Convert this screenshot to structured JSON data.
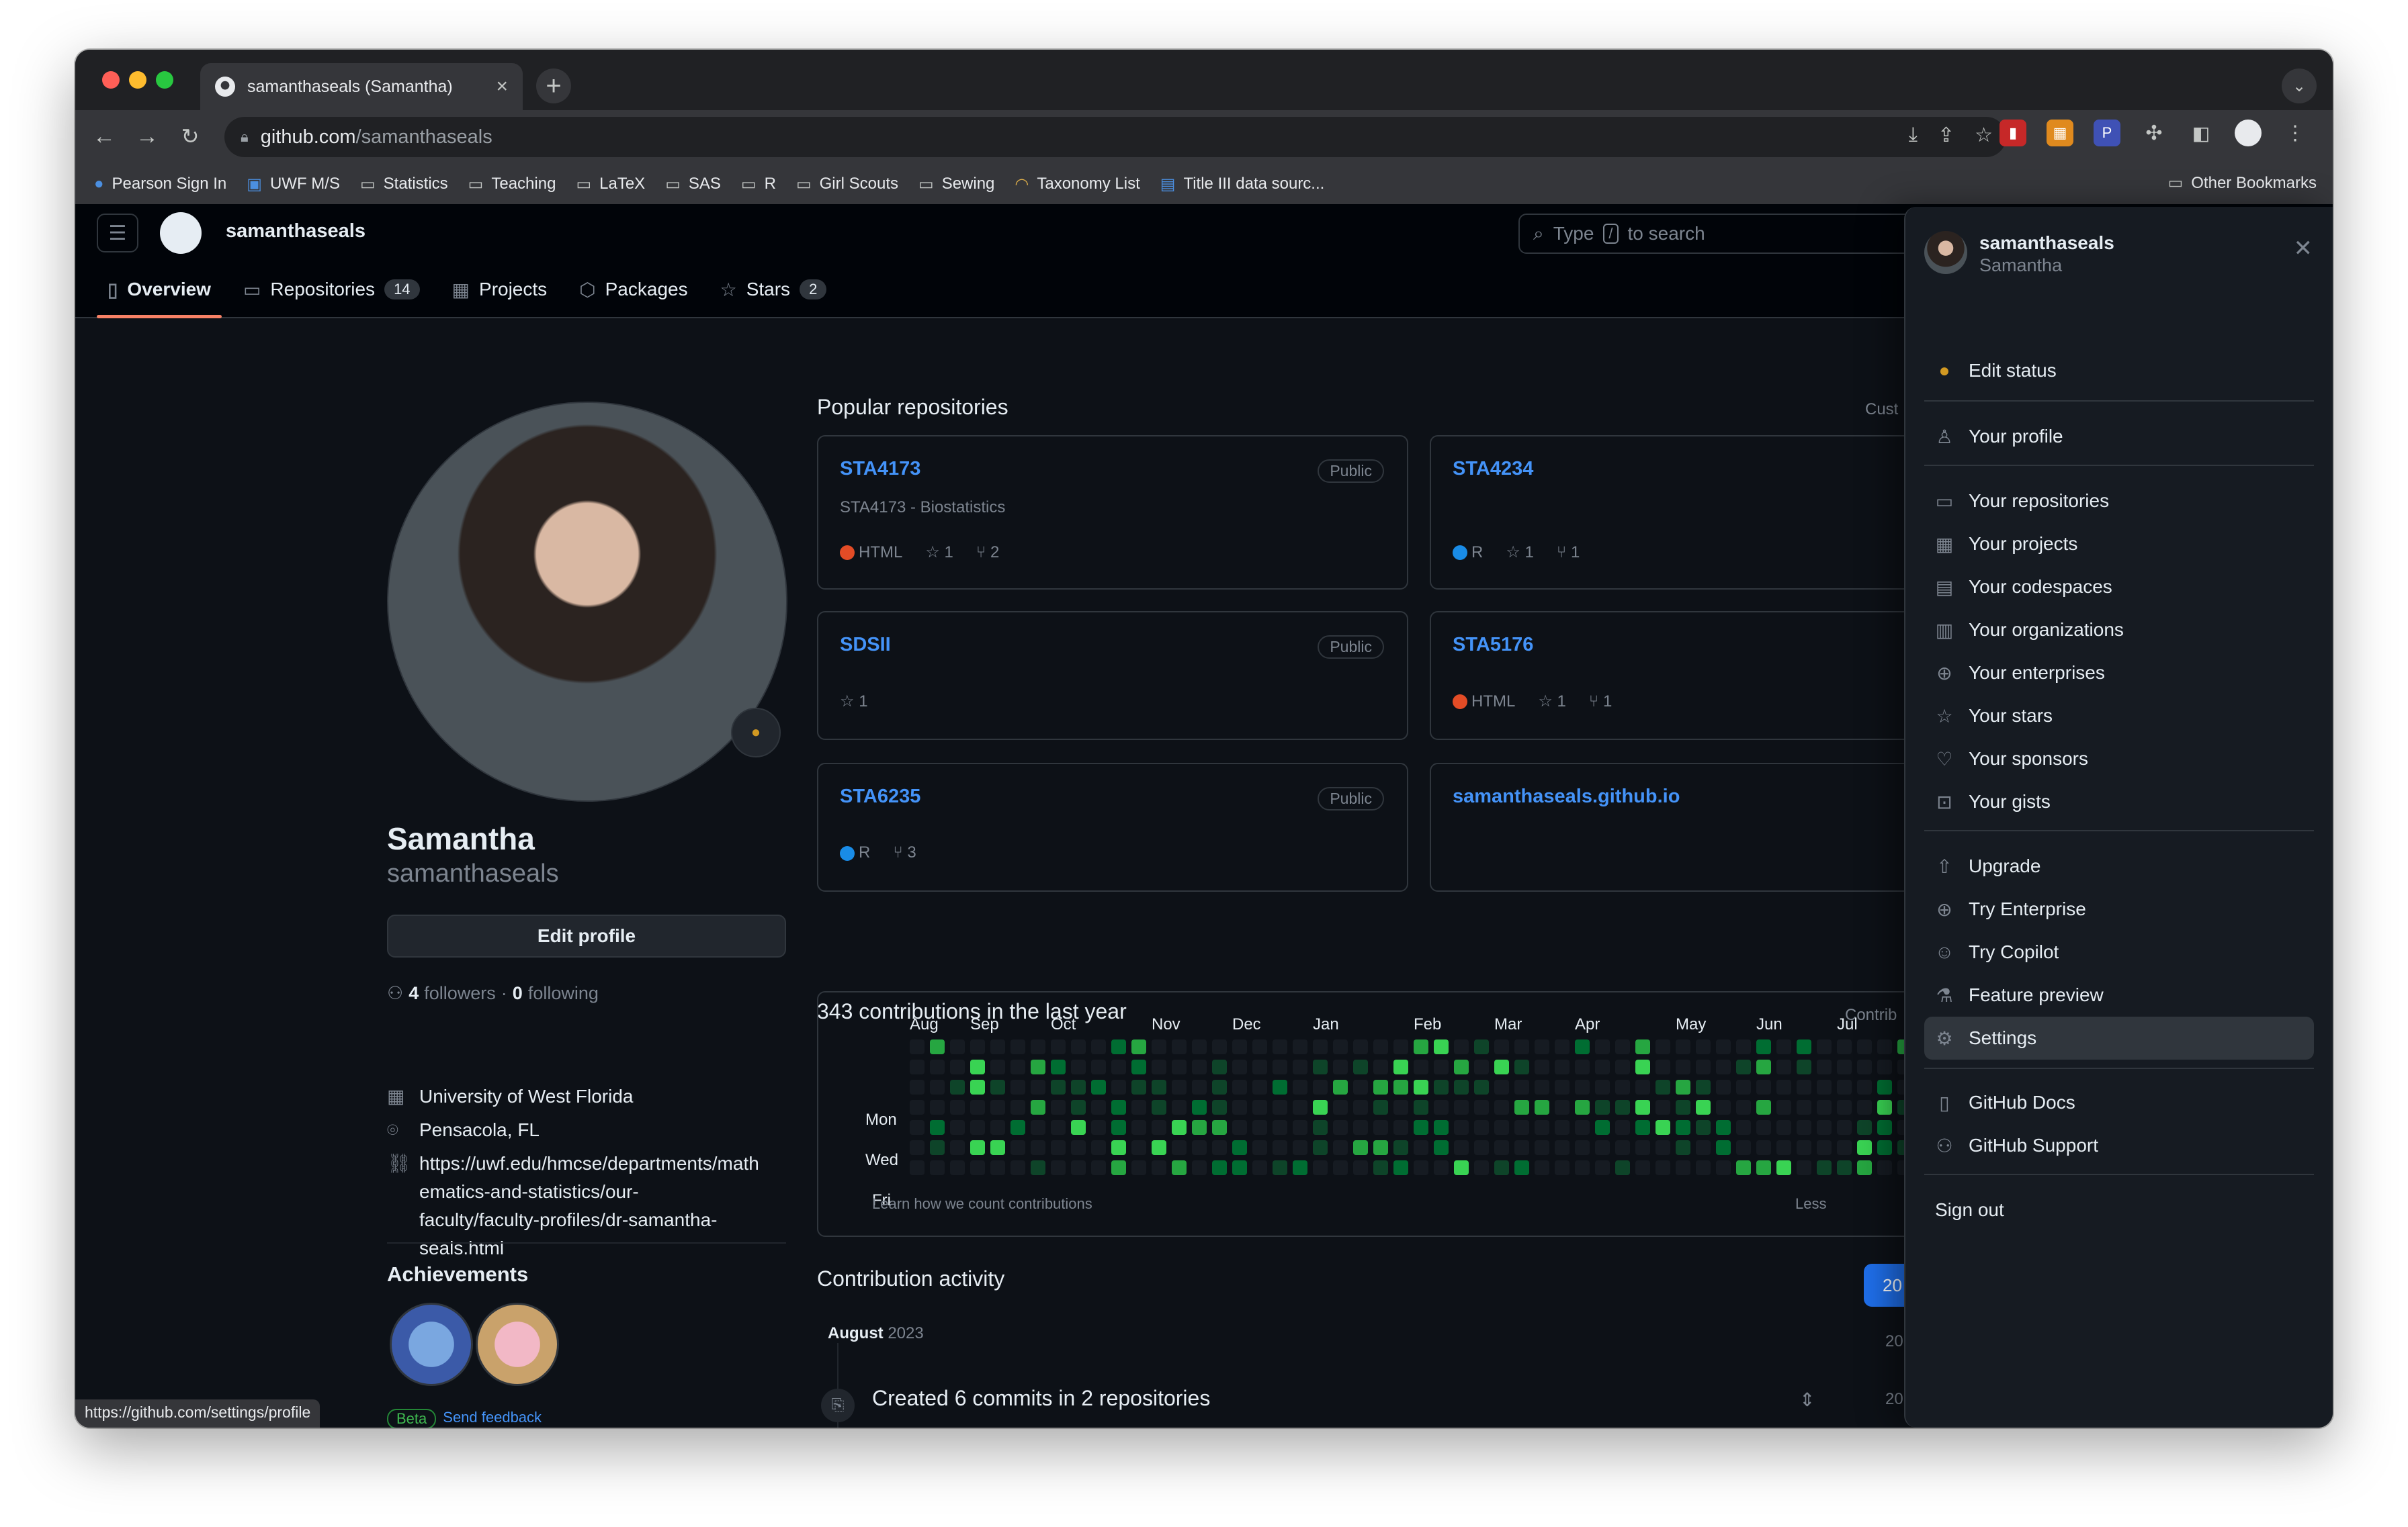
{
  "browser": {
    "tab_title": "samanthaseals (Samantha)",
    "url_host": "github.com",
    "url_path": "/samanthaseals",
    "status_url": "https://github.com/settings/profile"
  },
  "bookmarks": [
    "Pearson Sign In",
    "UWF M/S",
    "Statistics",
    "Teaching",
    "LaTeX",
    "SAS",
    "R",
    "Girl Scouts",
    "Sewing",
    "Taxonomy List",
    "Title III data sourc..."
  ],
  "bookmarks_other": "Other Bookmarks",
  "gh": {
    "username": "samanthaseals",
    "search_pre": "Type",
    "search_key": "/",
    "search_post": "to search",
    "tabs": {
      "overview": "Overview",
      "repositories": "Repositories",
      "repositories_count": "14",
      "projects": "Projects",
      "packages": "Packages",
      "stars": "Stars",
      "stars_count": "2"
    }
  },
  "profile": {
    "name": "Samantha",
    "login": "samanthaseals",
    "edit_profile": "Edit profile",
    "followers": "4",
    "followers_label": "followers",
    "dot": "·",
    "following": "0",
    "following_label": "following",
    "org": "University of West Florida",
    "location": "Pensacola, FL",
    "url_lines": [
      "https://uwf.edu/hmcse/departments/math",
      "ematics-and-statistics/our-",
      "faculty/faculty-profiles/dr-samantha-",
      "seals.html"
    ],
    "achievements_title": "Achievements",
    "beta": "Beta",
    "send_feedback": "Send feedback"
  },
  "popular": {
    "title": "Popular repositories",
    "customize": "Cust",
    "repos": [
      {
        "name": "STA4173",
        "visibility": "Public",
        "desc": "STA4173 - Biostatistics",
        "lang": "HTML",
        "lang_color": "#e34c26",
        "stars": "1",
        "forks": "2"
      },
      {
        "name": "STA4234",
        "visibility": "",
        "desc": "",
        "lang": "R",
        "lang_color": "#198ce7",
        "stars": "1",
        "forks": "1"
      },
      {
        "name": "SDSII",
        "visibility": "Public",
        "desc": "",
        "lang": "",
        "lang_color": "",
        "stars": "1",
        "forks": ""
      },
      {
        "name": "STA5176",
        "visibility": "",
        "desc": "",
        "lang": "HTML",
        "lang_color": "#e34c26",
        "stars": "1",
        "forks": "1"
      },
      {
        "name": "STA6235",
        "visibility": "Public",
        "desc": "",
        "lang": "R",
        "lang_color": "#198ce7",
        "stars": "",
        "forks": "3"
      },
      {
        "name": "samanthaseals.github.io",
        "visibility": "",
        "desc": "",
        "lang": "",
        "lang_color": "",
        "stars": "",
        "forks": ""
      }
    ]
  },
  "contributions": {
    "title": "343 contributions in the last year",
    "settings": "Contrib",
    "months": [
      "Aug",
      "Sep",
      "Oct",
      "Nov",
      "Dec",
      "Jan",
      "Feb",
      "Mar",
      "Apr",
      "May",
      "Jun",
      "Jul"
    ],
    "days": [
      "Mon",
      "Wed",
      "Fri"
    ],
    "learn": "Learn how we count contributions",
    "less": "Less"
  },
  "activity": {
    "title": "Contribution activity",
    "year": "20",
    "month": "August",
    "month_year": "2023",
    "item": "Created 6 commits in 2 repositories",
    "side_years": [
      "20",
      "20"
    ]
  },
  "menu": {
    "login": "samanthaseals",
    "name": "Samantha",
    "edit_status": "Edit status",
    "your_profile": "Your profile",
    "group2": [
      "Your repositories",
      "Your projects",
      "Your codespaces",
      "Your organizations",
      "Your enterprises",
      "Your stars",
      "Your sponsors",
      "Your gists"
    ],
    "group3": [
      "Upgrade",
      "Try Enterprise",
      "Try Copilot",
      "Feature preview",
      "Settings"
    ],
    "group4": [
      "GitHub Docs",
      "GitHub Support"
    ],
    "sign_out": "Sign out"
  },
  "colors": {
    "contrib_empty": "#161b22",
    "contrib_levels": [
      "#0e4429",
      "#006d32",
      "#26a641",
      "#39d353"
    ],
    "accent_link": "#4493f8",
    "tab_underline": "#f78166"
  }
}
